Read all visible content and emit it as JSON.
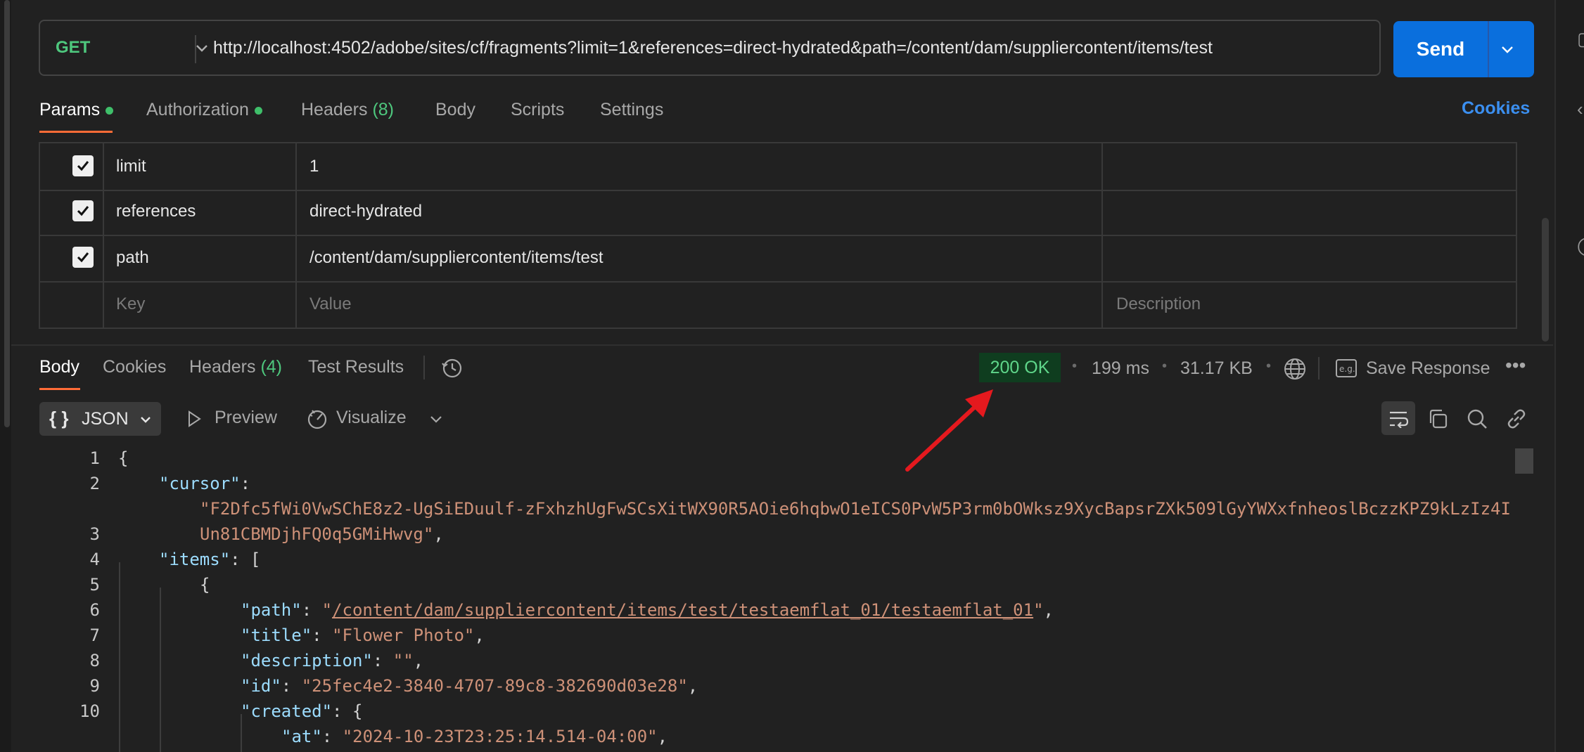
{
  "request": {
    "method": "GET",
    "url": "http://localhost:4502/adobe/sites/cf/fragments?limit=1&references=direct-hydrated&path=/content/dam/suppliercontent/items/test",
    "send_label": "Send"
  },
  "request_tabs": {
    "params": "Params",
    "authorization": "Authorization",
    "headers": "Headers",
    "headers_count": "(8)",
    "body": "Body",
    "scripts": "Scripts",
    "settings": "Settings",
    "cookies": "Cookies"
  },
  "params": [
    {
      "key": "limit",
      "value": "1",
      "checked": true
    },
    {
      "key": "references",
      "value": "direct-hydrated",
      "checked": true
    },
    {
      "key": "path",
      "value": "/content/dam/suppliercontent/items/test",
      "checked": true
    }
  ],
  "params_placeholder": {
    "key": "Key",
    "value": "Value",
    "description": "Description"
  },
  "response_tabs": {
    "body": "Body",
    "cookies": "Cookies",
    "headers": "Headers",
    "headers_count": "(4)",
    "test_results": "Test Results"
  },
  "response_meta": {
    "status": "200 OK",
    "time": "199 ms",
    "size": "31.17 KB",
    "save_response": "Save Response"
  },
  "body_toolbar": {
    "format": "JSON",
    "preview": "Preview",
    "visualize": "Visualize"
  },
  "code": {
    "line_numbers": [
      "1",
      "2",
      "3",
      "4",
      "5",
      "6",
      "7",
      "8",
      "9",
      "10"
    ],
    "cursor_key": "\"cursor\"",
    "cursor_value_1": "\"F2Dfc5fWi0VwSChE8z2-UgSiEDuulf-zFxhzhUgFwSCsXitWX90R5AOie6hqbwO1eICS0PvW5P3rm0bOWksz9XycBapsrZXk509lGyYWXxfnheoslBczzKPZ9kLzIz4I",
    "cursor_value_2": "Un81CBMDjhFQ0q5GMiHwvg\"",
    "items_key": "\"items\"",
    "path_key": "\"path\"",
    "path_value": "/content/dam/suppliercontent/items/test/testaemflat_01/testaemflat_01",
    "title_key": "\"title\"",
    "title_value": "\"Flower Photo\"",
    "description_key": "\"description\"",
    "description_value": "\"\"",
    "id_key": "\"id\"",
    "id_value": "\"25fec4e2-3840-4707-89c8-382690d03e28\"",
    "created_key": "\"created\"",
    "at_key": "\"at\"",
    "at_value": "\"2024-10-23T23:25:14.514-04:00\""
  },
  "colors": {
    "accent": "#ff6c37",
    "send": "#0a6fdd",
    "status_bg": "#0f3d1f",
    "status_text": "#5fd68a",
    "annotation_arrow": "#e5191e"
  }
}
